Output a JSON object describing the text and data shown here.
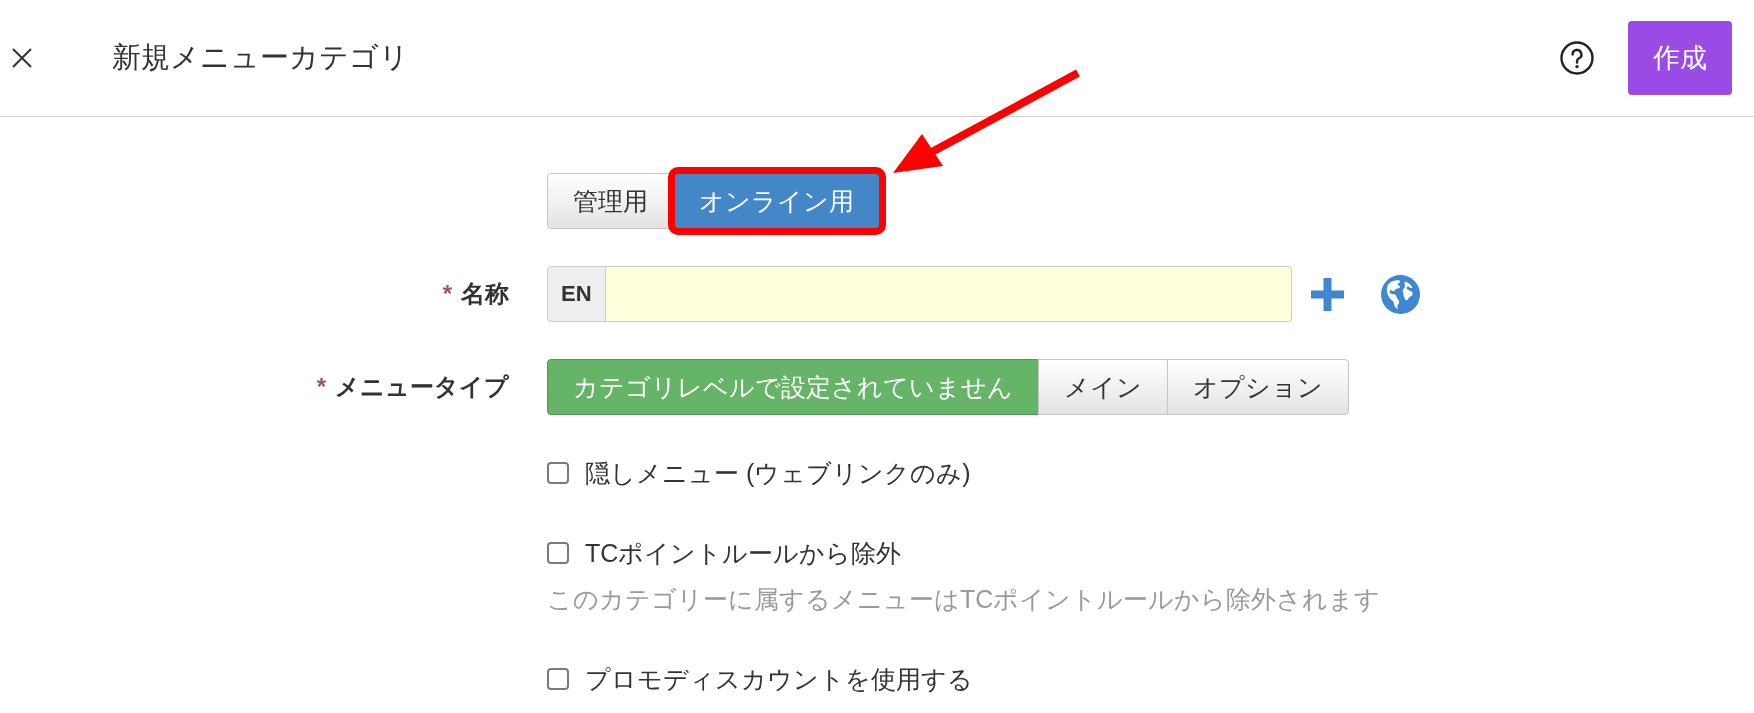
{
  "header": {
    "title": "新規メニューカテゴリ",
    "create_button": "作成"
  },
  "channel_tabs": [
    {
      "label": "管理用",
      "selected": false,
      "highlighted": false
    },
    {
      "label": "オンライン用",
      "selected": true,
      "highlighted": true
    }
  ],
  "fields": [
    {
      "kind": "translatable_text",
      "required_mark": "*",
      "label": "名称",
      "language": "EN"
    },
    {
      "kind": "choice",
      "required_mark": "*",
      "label": "メニュータイプ",
      "options": [
        {
          "label": "カテゴリレベルで設定されていません",
          "selected": true
        },
        {
          "label": "メイン",
          "selected": false
        },
        {
          "label": "オプション",
          "selected": false
        }
      ]
    }
  ],
  "checkboxes": [
    {
      "label": "隠しメニュー (ウェブリンクのみ)",
      "checked": false
    },
    {
      "label": "TCポイントルールから除外",
      "checked": false,
      "hint": "このカテゴリーに属するメニューはTCポイントルールから除外されます"
    },
    {
      "label": "プロモディスカウントを使用する",
      "checked": false
    }
  ]
}
